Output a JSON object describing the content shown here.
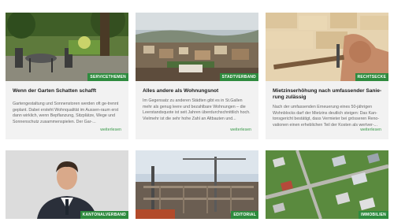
{
  "cards": [
    {
      "category": "SERVICETHEMEN",
      "title": "Wenn der Garten Schatten schafft",
      "excerpt": "Gartengestaltung und Sonnenstoren werden oft ge-trennt geplant. Dabei ersteht Wohnqualität im Aussen-raum erst dann wirklich, wenn Bepflanzung, Sitzplätze, Wege und Sonnenschutz zusammenspielen. Der Gar-...",
      "more": "weiterlesen"
    },
    {
      "category": "STADTVERBAND",
      "title": "Alles andere als Wohnungsnot",
      "excerpt": "Im Gegensatz zu anderen Städten gibt es in St.Gallen mehr als genug leere und bezahlbare Wohnungen – die Leerstandsquote ist seit Jahren überdurchschnittlich hoch. Vielmehr ist die sehr hohe Zahl an Altbauten und...",
      "more": "weiterlesen"
    },
    {
      "category": "RECHTSECKE",
      "title": "Mietzinserhöhung nach umfassender Sanie-rung zulässig",
      "excerpt": "Nach der umfassenden Erneuerung eines 50-jährigen Wohnblocks darf der Mietzins deutlich steigen: Das Kan-tonsgericht bestätigt, dass Vermieter bei grösseren Reno-vationen einen erheblichen Teil der Kosten als wertver-...",
      "more": "weiterlesen"
    },
    {
      "category": "KANTONALVERBAND"
    },
    {
      "category": "EDITORIAL"
    },
    {
      "category": "IMMOBILIEN"
    }
  ],
  "colors": {
    "accent": "#2e8b3e",
    "link": "#3a9a4a",
    "card_bg": "#f2f2f2"
  }
}
